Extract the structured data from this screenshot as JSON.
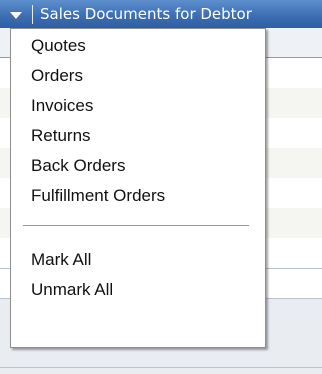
{
  "window": {
    "title": "Sales Documents for Debtor",
    "dropdown_icon": "chevron-down-icon"
  },
  "grid": {
    "column_header_fragment": "nt"
  },
  "menu": {
    "items": [
      {
        "label": "Quotes"
      },
      {
        "label": "Orders"
      },
      {
        "label": "Invoices"
      },
      {
        "label": "Returns"
      },
      {
        "label": "Back Orders"
      },
      {
        "label": "Fulfillment Orders"
      }
    ],
    "actions": [
      {
        "label": "Mark  All"
      },
      {
        "label": "Unmark  All"
      }
    ]
  },
  "colors": {
    "titlebar_top": "#5d8fce",
    "titlebar_bottom": "#2f5ea2",
    "menu_border": "#8e8e8e",
    "row_alt": "#f5f6f1"
  }
}
